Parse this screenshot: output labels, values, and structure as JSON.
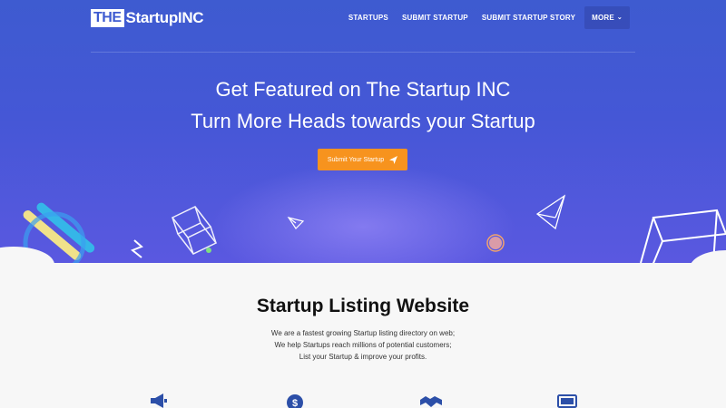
{
  "brand": {
    "logo_box": "THE",
    "logo_text": "StartupINC"
  },
  "nav": {
    "items": [
      "STARTUPS",
      "SUBMIT STARTUP",
      "SUBMIT STARTUP STORY"
    ],
    "more": "MORE"
  },
  "hero": {
    "line1": "Get Featured on The Startup INC",
    "line2": "Turn More Heads towards your Startup",
    "cta": "Submit Your Startup"
  },
  "section": {
    "title": "Startup Listing Website",
    "lines": [
      "We are a fastest growing Startup listing directory on web;",
      "We help Startups reach millions of potential customers;",
      "List your Startup & improve your profits."
    ]
  },
  "icons": [
    "megaphone-icon",
    "dollar-icon",
    "handshake-icon",
    "monitor-icon"
  ],
  "colors": {
    "hero": "#4557d6",
    "cta": "#f7931e",
    "background": "#f7f7f7"
  }
}
